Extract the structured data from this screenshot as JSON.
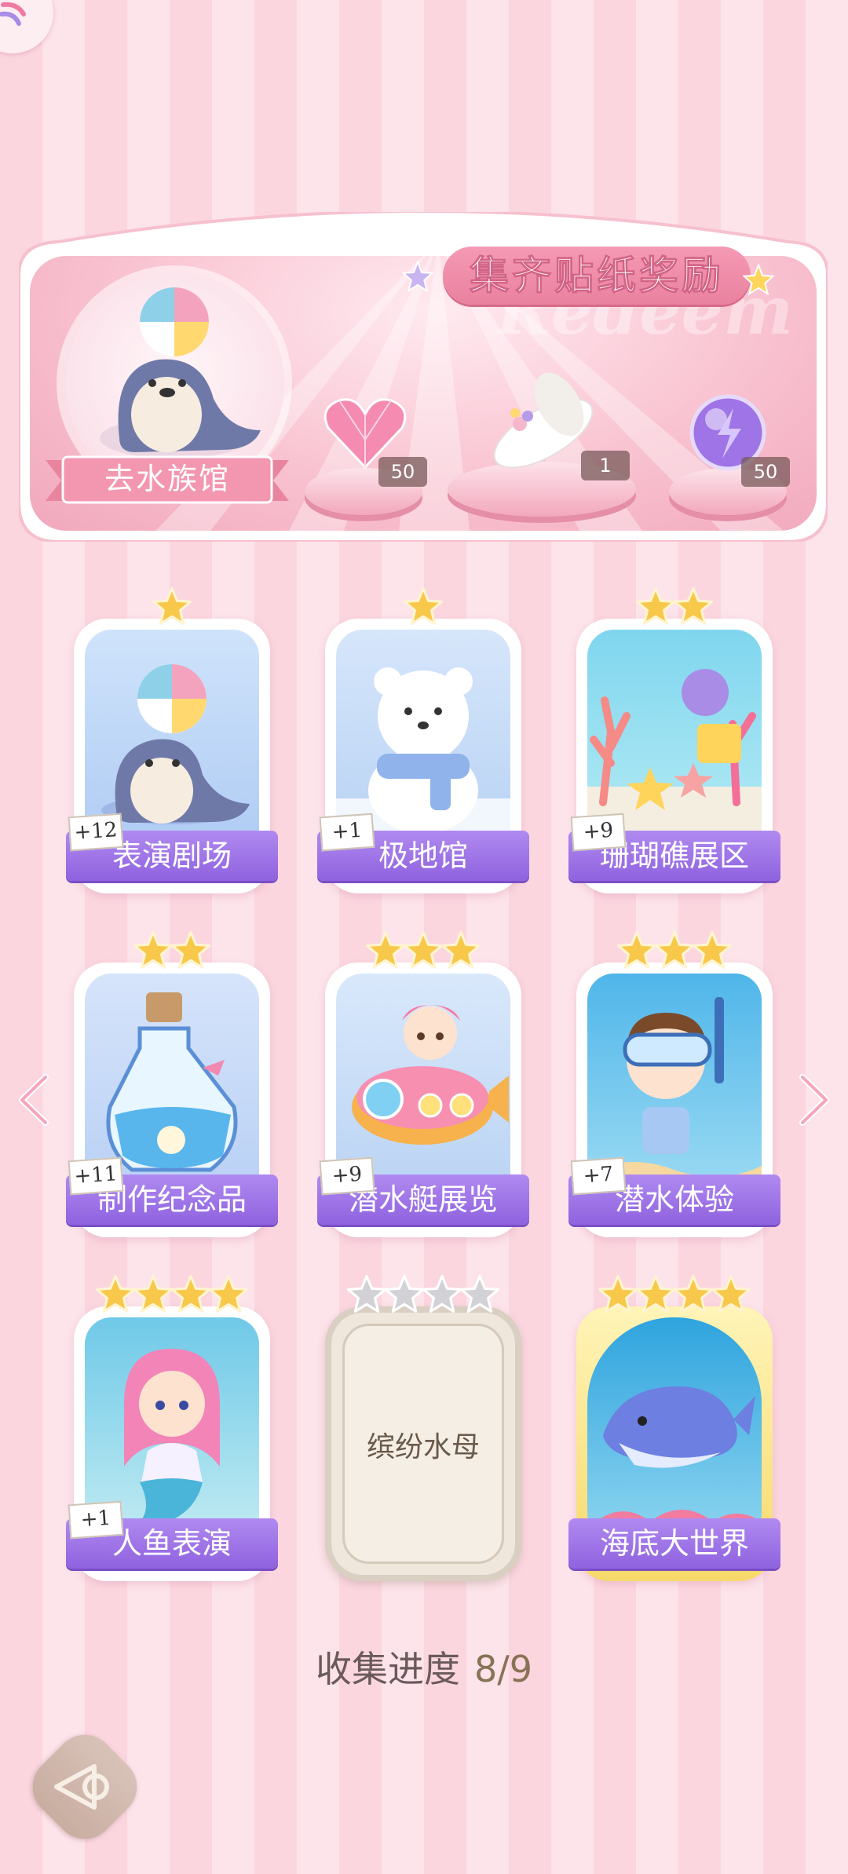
{
  "banner": {
    "title": "集齐贴纸奖励",
    "watermark": "Redeem",
    "location_label": "去水族馆",
    "rewards": [
      {
        "icon": "pink-heart-gem-icon",
        "count": "50"
      },
      {
        "icon": "flower-hat-icon",
        "count": "1"
      },
      {
        "icon": "purple-energy-orb-icon",
        "count": "50"
      }
    ]
  },
  "cards": [
    {
      "label": "表演剧场",
      "bonus": "+12",
      "stars": 1,
      "locked": false,
      "icon": "seal-ball-icon"
    },
    {
      "label": "极地馆",
      "bonus": "+1",
      "stars": 1,
      "locked": false,
      "icon": "polar-bear-icon"
    },
    {
      "label": "珊瑚礁展区",
      "bonus": "+9",
      "stars": 2,
      "locked": false,
      "icon": "coral-reef-icon"
    },
    {
      "label": "制作纪念品",
      "bonus": "+11",
      "stars": 2,
      "locked": false,
      "icon": "bottle-souvenir-icon"
    },
    {
      "label": "潜水艇展览",
      "bonus": "+9",
      "stars": 3,
      "locked": false,
      "icon": "submarine-icon"
    },
    {
      "label": "潜水体验",
      "bonus": "+7",
      "stars": 3,
      "locked": false,
      "icon": "snorkel-diver-icon"
    },
    {
      "label": "人鱼表演",
      "bonus": "+1",
      "stars": 4,
      "locked": false,
      "icon": "mermaid-icon"
    },
    {
      "label": "缤纷水母",
      "bonus": "",
      "stars": 4,
      "locked": true,
      "icon": "locked-card-icon"
    },
    {
      "label": "海底大世界",
      "bonus": "",
      "stars": 4,
      "locked": false,
      "icon": "whale-icon"
    }
  ],
  "progress": {
    "label": "收集进度",
    "value": "8/9",
    "fraction": 0.889
  },
  "colors": {
    "label_purple": "#9a6ee6",
    "gold_star": "#f5c64a",
    "grey_star": "#c9c9c9",
    "title_pink": "#ee8aa8"
  }
}
